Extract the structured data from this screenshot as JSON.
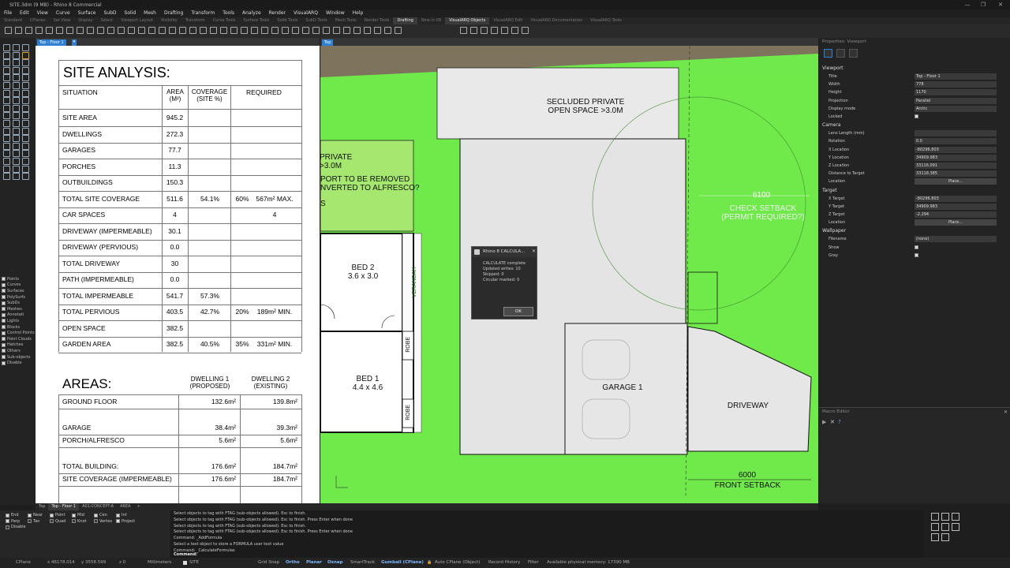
{
  "window": {
    "title": "SITE.3dm (9 MB) - Rhino 8 Commercial"
  },
  "menu": [
    "File",
    "Edit",
    "View",
    "Curve",
    "Surface",
    "SubD",
    "Solid",
    "Mesh",
    "Drafting",
    "Transform",
    "Tools",
    "Analyze",
    "Render",
    "VisualARQ",
    "Window",
    "Help"
  ],
  "toolbar_tabs": [
    {
      "label": "Standard",
      "active": false
    },
    {
      "label": "CPlanes",
      "active": false
    },
    {
      "label": "Set View",
      "active": false
    },
    {
      "label": "Display",
      "active": false
    },
    {
      "label": "Select",
      "active": false
    },
    {
      "label": "Viewport Layout",
      "active": false
    },
    {
      "label": "Visibility",
      "active": false
    },
    {
      "label": "Transform",
      "active": false
    },
    {
      "label": "Curve Tools",
      "active": false
    },
    {
      "label": "Surface Tools",
      "active": false
    },
    {
      "label": "Solid Tools",
      "active": false
    },
    {
      "label": "SubD Tools",
      "active": false
    },
    {
      "label": "Mesh Tools",
      "active": false
    },
    {
      "label": "Render Tools",
      "active": false
    },
    {
      "label": "Drafting",
      "active": true
    },
    {
      "label": "New in V8",
      "active": false
    },
    {
      "label": "VisualARQ Objects",
      "active": true
    },
    {
      "label": "VisualARQ Edit",
      "active": false
    },
    {
      "label": "VisualARQ Documentation",
      "active": false
    },
    {
      "label": "VisualARQ Tools",
      "active": false
    }
  ],
  "left_viewport": {
    "label": "Top - Floor 1"
  },
  "right_viewport": {
    "label": "Top"
  },
  "site_analysis": {
    "title": "SITE ANALYSIS:",
    "headers": {
      "situation": "SITUATION",
      "area": "AREA (M²)",
      "coverage": "COVERAGE (SITE %)",
      "required": "REQUIRED"
    },
    "rows": [
      {
        "situation": "SITE AREA",
        "area": "945.2",
        "coverage": "",
        "req_pct": "",
        "req_val": ""
      },
      {
        "situation": "DWELLINGS",
        "area": "272.3",
        "coverage": "",
        "req_pct": "",
        "req_val": ""
      },
      {
        "situation": "GARAGES",
        "area": "77.7",
        "coverage": "",
        "req_pct": "",
        "req_val": ""
      },
      {
        "situation": "PORCHES",
        "area": "11.3",
        "coverage": "",
        "req_pct": "",
        "req_val": ""
      },
      {
        "situation": "OUTBUILDINGS",
        "area": "150.3",
        "coverage": "",
        "req_pct": "",
        "req_val": ""
      },
      {
        "situation": "TOTAL SITE COVERAGE",
        "area": "511.6",
        "coverage": "54.1%",
        "req_pct": "60%",
        "req_val": "567m² MAX."
      },
      {
        "situation": "CAR SPACES",
        "area": "4",
        "coverage": "",
        "req_pct": "",
        "req_val": "4"
      },
      {
        "situation": "DRIVEWAY (IMPERMEABLE)",
        "area": "30.1",
        "coverage": "",
        "req_pct": "",
        "req_val": ""
      },
      {
        "situation": "DRIVEWAY (PERVIOUS)",
        "area": "0.0",
        "coverage": "",
        "req_pct": "",
        "req_val": ""
      },
      {
        "situation": "TOTAL DRIVEWAY",
        "area": "30",
        "coverage": "",
        "req_pct": "",
        "req_val": ""
      },
      {
        "situation": "PATH (IMPERMEABLE)",
        "area": "0.0",
        "coverage": "",
        "req_pct": "",
        "req_val": ""
      },
      {
        "situation": "TOTAL IMPERMEABLE",
        "area": "541.7",
        "coverage": "57.3%",
        "req_pct": "",
        "req_val": ""
      },
      {
        "situation": "TOTAL PERVIOUS",
        "area": "403.5",
        "coverage": "42.7%",
        "req_pct": "20%",
        "req_val": "189m² MIN."
      },
      {
        "situation": "OPEN SPACE",
        "area": "382.5",
        "coverage": "",
        "req_pct": "",
        "req_val": ""
      },
      {
        "situation": "GARDEN AREA",
        "area": "382.5",
        "coverage": "40.5%",
        "req_pct": "35%",
        "req_val": "331m² MIN."
      }
    ]
  },
  "areas": {
    "title": "AREAS:",
    "col1": "DWELLING 1 (PROPOSED)",
    "col2": "DWELLING 2 (EXISTING)",
    "rows": [
      {
        "label": "GROUND FLOOR",
        "d1": "132.6m²",
        "d2": "139.8m²"
      },
      {
        "label": "GARAGE",
        "d1": "38.4m²",
        "d2": "39.3m²"
      },
      {
        "label": "PORCH/ALFRESCO",
        "d1": "5.6m²",
        "d2": "5.6m²"
      },
      {
        "label": "TOTAL BUILDING:",
        "d1": "176.6m²",
        "d2": "184.7m²"
      },
      {
        "label": "SITE COVERAGE (IMPERMEABLE)",
        "d1": "176.6m²",
        "d2": "184.7m²"
      }
    ]
  },
  "plan": {
    "secluded": "SECLUDED PRIVATE\nOPEN SPACE >3.0M",
    "private_left": "PRIVATE\n>3.0M",
    "carport": "PORT TO BE REMOVED\nNVERTED TO ALFRESCO?",
    "s_letter": "S",
    "bed2": "BED 2\n3.6 x 3.0",
    "bed1": "BED 1\n4.4 x 4.6",
    "verandah": "VERANDAH",
    "robe1": "ROBE",
    "robe2": "ROBE",
    "garage": "GARAGE 1",
    "driveway": "DRIVEWAY",
    "dim_front": "6000",
    "front_setback": "FRONT SETBACK",
    "dim_side": "6100",
    "check_setback": "CHECK SETBACK\n(PERMIT REQUIRED?)"
  },
  "dialog": {
    "title": "Rhino 8  CALCULA...",
    "lines": [
      "CALCULATE complete",
      "Updated writes: 10",
      "Skipped: 0",
      "Circular marked: 0"
    ],
    "ok": "OK"
  },
  "properties": {
    "title": "Properties: Viewport",
    "viewport_section": "Viewport",
    "fields": [
      {
        "label": "Title",
        "value": "Top - Floor 1"
      },
      {
        "label": "Width",
        "value": "778"
      },
      {
        "label": "Height",
        "value": "1170"
      },
      {
        "label": "Projection",
        "value": "Parallel"
      },
      {
        "label": "Display mode",
        "value": "Arctic"
      },
      {
        "label": "Locked",
        "value": ""
      }
    ],
    "camera_section": "Camera",
    "camera": [
      {
        "label": "Lens Length (mm)",
        "value": ""
      },
      {
        "label": "Rotation",
        "value": "0.0"
      },
      {
        "label": "X Location",
        "value": "-80296.803"
      },
      {
        "label": "Y Location",
        "value": "34909.983"
      },
      {
        "label": "Z Location",
        "value": "33116.091"
      },
      {
        "label": "Distance to Target",
        "value": "33118.385"
      },
      {
        "label": "Location",
        "value": "Place..."
      }
    ],
    "target_section": "Target",
    "target": [
      {
        "label": "X Target",
        "value": "-80296.803"
      },
      {
        "label": "Y Target",
        "value": "34909.983"
      },
      {
        "label": "Z Target",
        "value": "-2.294"
      },
      {
        "label": "Location",
        "value": "Place..."
      }
    ],
    "wallpaper_section": "Wallpaper",
    "wallpaper": [
      {
        "label": "Filename",
        "value": "(none)"
      },
      {
        "label": "Show",
        "value": ""
      },
      {
        "label": "Gray",
        "value": ""
      }
    ]
  },
  "macro": {
    "title": "Macro Editor"
  },
  "layer_filters": [
    "Points",
    "Curves",
    "Surfaces",
    "PolySurfs",
    "SubDs",
    "Meshes",
    "Annotati",
    "Lights",
    "Blocks",
    "Control Points",
    "Point Clouds",
    "Hatches",
    "Others",
    "Sub-objects",
    "Disable"
  ],
  "bottom_tabs": [
    {
      "label": "Top",
      "active": false
    },
    {
      "label": "Top - Floor 1",
      "active": true
    },
    {
      "label": "A01:CONCEPT-A",
      "active": false
    },
    {
      "label": "AREA",
      "active": false
    },
    {
      "label": "+",
      "active": false
    }
  ],
  "osnaps": [
    {
      "label": "End",
      "on": true
    },
    {
      "label": "Near",
      "on": true
    },
    {
      "label": "Point",
      "on": true
    },
    {
      "label": "Mid",
      "on": true
    },
    {
      "label": "Cen",
      "on": true
    },
    {
      "label": "Int",
      "on": true
    },
    {
      "label": "Perp",
      "on": true
    },
    {
      "label": "Tan",
      "on": false
    },
    {
      "label": "Quad",
      "on": false
    },
    {
      "label": "Knot",
      "on": false
    },
    {
      "label": "Vertex",
      "on": false
    },
    {
      "label": "Project",
      "on": true
    },
    {
      "label": "Disable",
      "on": false
    }
  ],
  "command_history": [
    "Select objects to tag with FTAG (sub-objects allowed). Esc to finish.",
    "Select objects to tag with FTAG (sub-objects allowed). Esc to finish. Press Enter when done",
    "Select objects to tag with FTAG (sub-objects allowed). Esc to finish.",
    "Select objects to tag with FTAG (sub-objects allowed). Esc to finish. Press Enter when done",
    "Command: _AddFormula",
    "Select a text object to store a FORMULA user text value",
    "Command: _CalculateFormulas"
  ],
  "command_prompt": "Command:",
  "status": {
    "cplane": "CPlane",
    "x": "x 46178.014",
    "y": "y 3558.599",
    "z": "z 0",
    "units": "Millimeters",
    "layer": "SITE",
    "grid_snap": "Grid Snap",
    "ortho": "Ortho",
    "planar": "Planar",
    "osnap": "Osnap",
    "smarttrack": "SmartTrack",
    "gumball": "Gumball (CPlane)",
    "autocplane": "Auto CPlane (Object)",
    "record": "Record History",
    "filter": "Filter",
    "memory": "Available physical memory: 17390 MB"
  },
  "colors": {
    "site_green": "#6fef4a",
    "accent_blue": "#2f7fd2",
    "dialog_bg": "#2b2b2b"
  }
}
